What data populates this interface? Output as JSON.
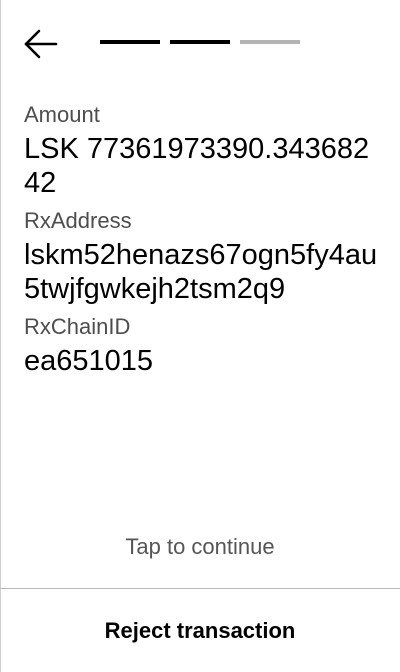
{
  "header": {
    "back_icon": "arrow-left-icon",
    "progress": {
      "total_steps": 3,
      "completed_steps": 2,
      "active_color": "#000000",
      "inactive_color": "#b3b3b3"
    }
  },
  "fields": {
    "amount": {
      "label": "Amount",
      "value": "LSK 77361973390.34368242"
    },
    "rx_address": {
      "label": "RxAddress",
      "value": "lskm52henazs67ogn5fy4au5twjfgwkejh2tsm2q9"
    },
    "rx_chain_id": {
      "label": "RxChainID",
      "value": "ea651015"
    }
  },
  "footer": {
    "tap_to_continue": "Tap to continue",
    "reject_label": "Reject transaction"
  }
}
